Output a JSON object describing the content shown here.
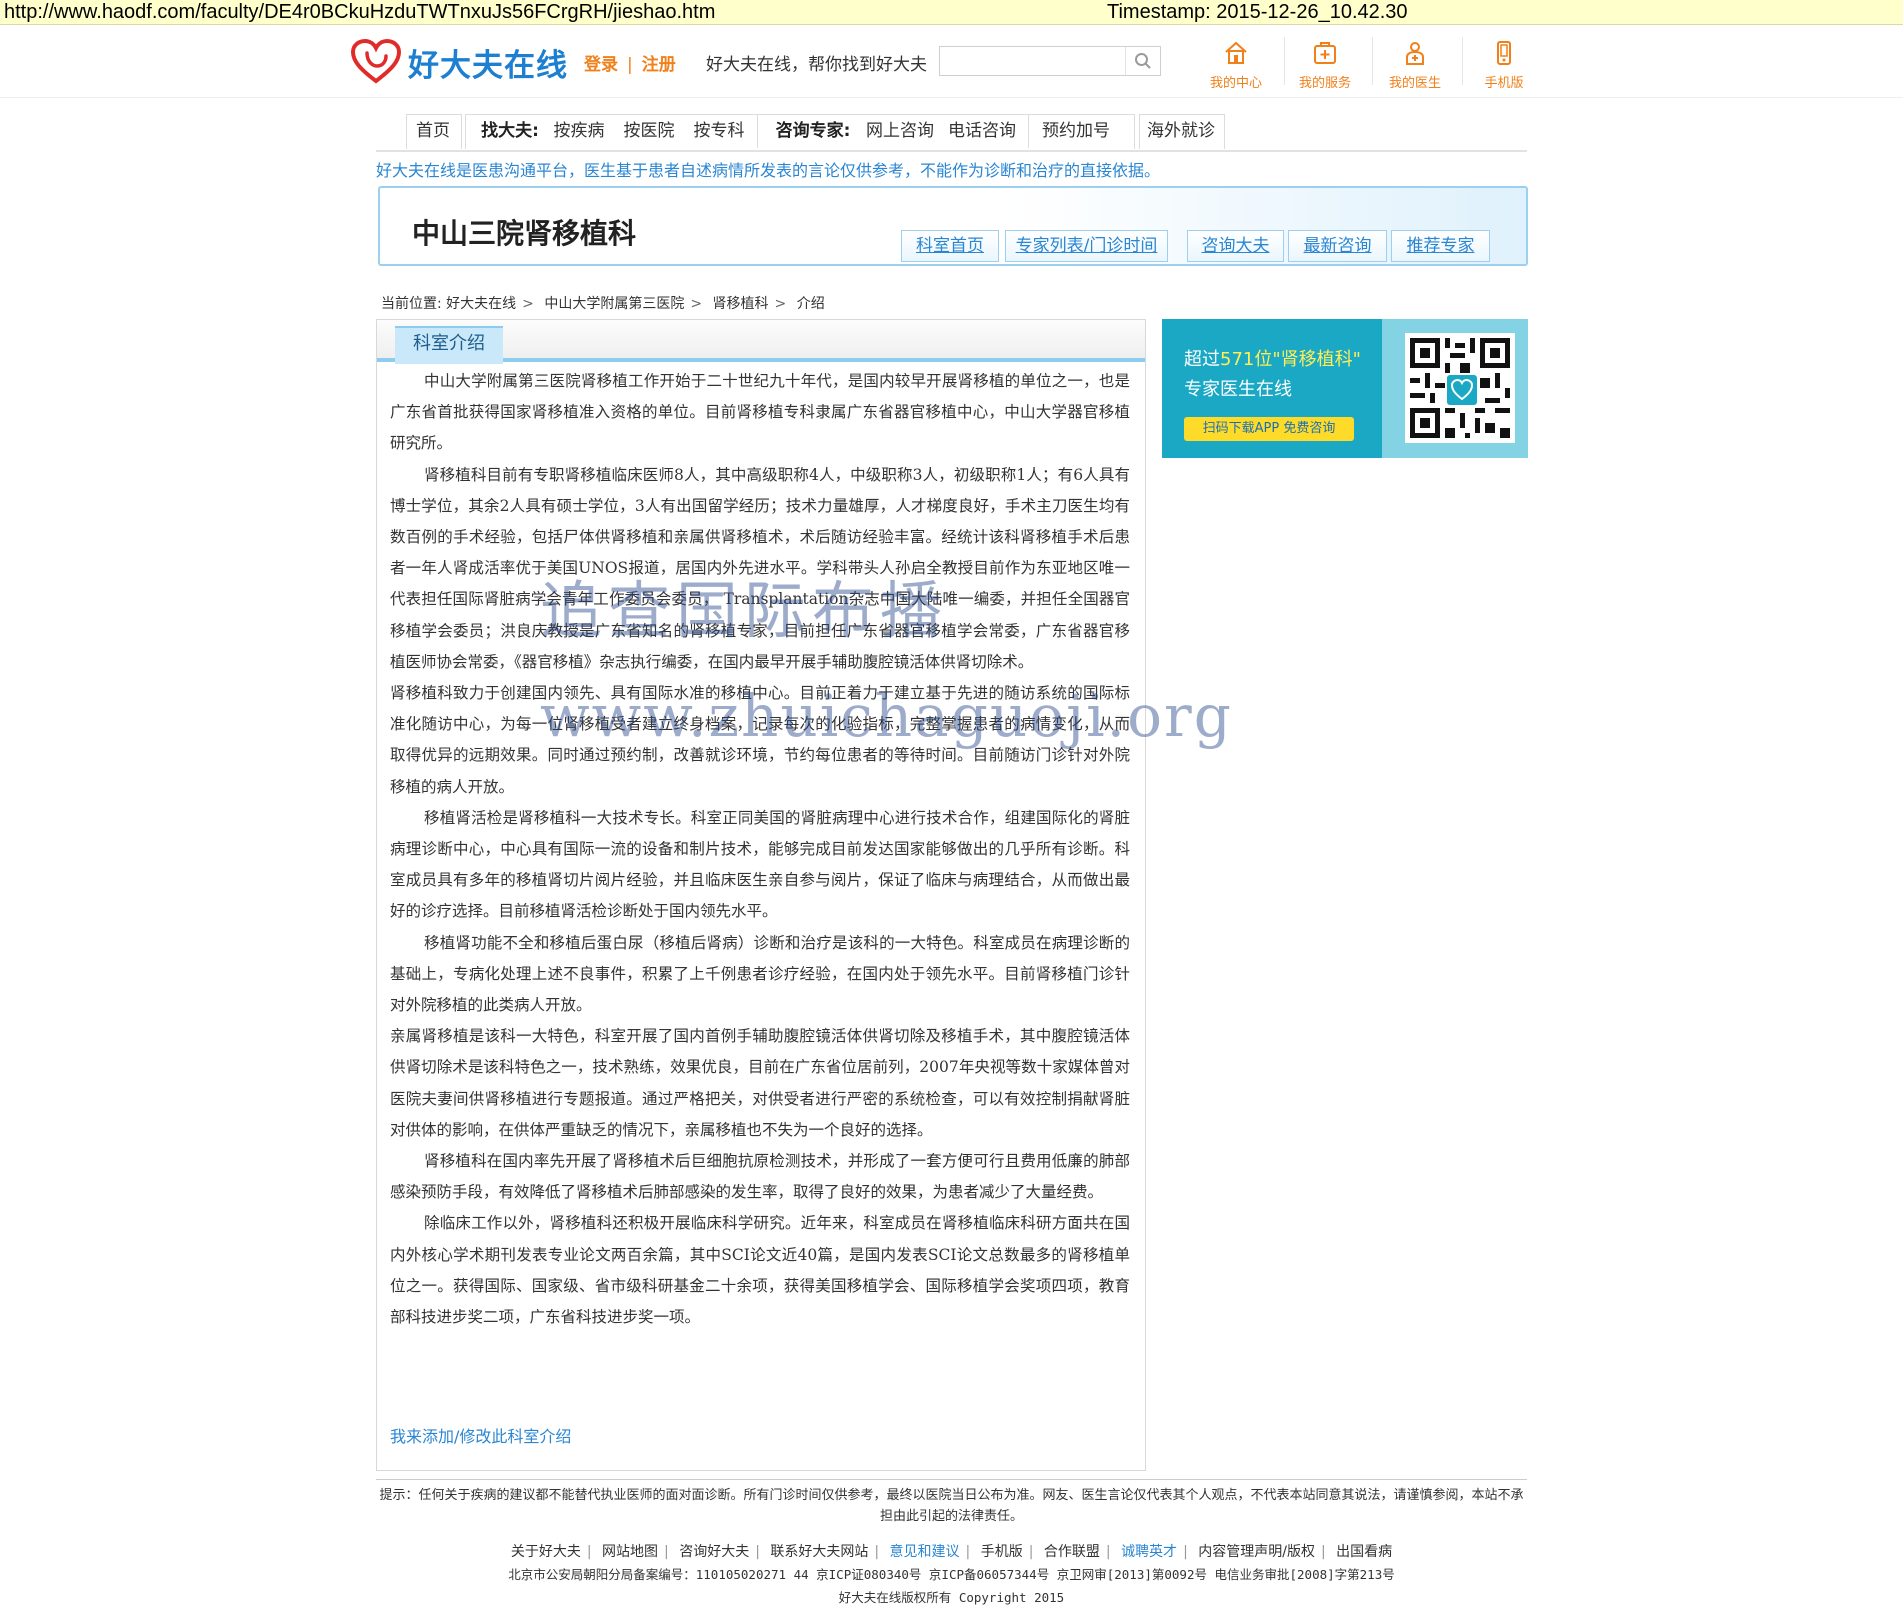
{
  "archive": {
    "url": "http://www.haodf.com/faculty/DE4r0BCkuHzduTWTnxuJs56FCrgRH/jieshao.htm",
    "timestamp": "Timestamp: 2015-12-26_10.42.30"
  },
  "header": {
    "logo_text": "好大夫在线",
    "login": "登录",
    "separator": "|",
    "register": "注册",
    "slogan": "好大夫在线，帮你找到好大夫",
    "search_placeholder": "",
    "nav": [
      {
        "label": "我的中心",
        "icon": "home-icon"
      },
      {
        "label": "我的服务",
        "icon": "medical-kit-icon"
      },
      {
        "label": "我的医生",
        "icon": "doctor-icon"
      },
      {
        "label": "手机版",
        "icon": "mobile-phone-icon"
      }
    ]
  },
  "mainnav": {
    "home": "首页",
    "find_doctor": "找大夫:",
    "by_disease": "按疾病",
    "by_hospital": "按医院",
    "by_department": "按专科",
    "consult": "咨询专家:",
    "online_consult": "网上咨询",
    "phone_consult": "电话咨询",
    "appointment": "预约加号",
    "overseas": "海外就诊"
  },
  "notice": "好大夫在线是医患沟通平台，医生基于患者自述病情所发表的言论仅供参考，不能作为诊断和治疗的直接依据。",
  "department": {
    "title": "中山三院肾移植科",
    "tabs": [
      "科室首页",
      "专家列表/门诊时间",
      "咨询大夫",
      "最新咨询",
      "推荐专家"
    ]
  },
  "breadcrumb": {
    "current": "当前位置:",
    "items": [
      "好大夫在线",
      "中山大学附属第三医院",
      "肾移植科",
      "介绍"
    ]
  },
  "content": {
    "tab": "科室介绍",
    "paragraphs": [
      {
        "indent": true,
        "text": "中山大学附属第三医院肾移植工作开始于二十世纪九十年代，是国内较早开展肾移植的单位之一，也是广东省首批获得国家肾移植准入资格的单位。目前肾移植专科隶属广东省器官移植中心，中山大学器官移植研究所。"
      },
      {
        "indent": true,
        "text": "肾移植科目前有专职肾移植临床医师8人，其中高级职称4人，中级职称3人，初级职称1人；有6人具有博士学位，其余2人具有硕士学位，3人有出国留学经历；技术力量雄厚，人才梯度良好，手术主刀医生均有数百例的手术经验，包括尸体供肾移植和亲属供肾移植术，术后随访经验丰富。经统计该科肾移植手术后患者一年人肾成活率优于美国UNOS报道，居国内外先进水平。学科带头人孙启全教授目前作为东亚地区唯一代表担任国际肾脏病学会青年工作委员会委员， Transplantation杂志中国大陆唯一编委，并担任全国器官移植学会委员；洪良庆教授是广东省知名的肾移植专家，目前担任广东省器官移植学会常委，广东省器官移植医师协会常委，《器官移植》杂志执行编委，在国内最早开展手辅助腹腔镜活体供肾切除术。"
      },
      {
        "indent": false,
        "text": "肾移植科致力于创建国内领先、具有国际水准的移植中心。目前正着力于建立基于先进的随访系统的国际标准化随访中心，为每一位肾移植受者建立终身档案，记录每次的化验指标，完整掌握患者的病情变化，从而取得优异的远期效果。同时通过预约制，改善就诊环境，节约每位患者的等待时间。目前随访门诊针对外院移植的病人开放。"
      },
      {
        "indent": true,
        "text": "移植肾活检是肾移植科一大技术专长。科室正同美国的肾脏病理中心进行技术合作，组建国际化的肾脏病理诊断中心，中心具有国际一流的设备和制片技术，能够完成目前发达国家能够做出的几乎所有诊断。科室成员具有多年的移植肾切片阅片经验，并且临床医生亲自参与阅片，保证了临床与病理结合，从而做出最好的诊疗选择。目前移植肾活检诊断处于国内领先水平。"
      },
      {
        "indent": true,
        "text": "移植肾功能不全和移植后蛋白尿（移植后肾病）诊断和治疗是该科的一大特色。科室成员在病理诊断的基础上，专病化处理上述不良事件，积累了上千例患者诊疗经验，在国内处于领先水平。目前肾移植门诊针对外院移植的此类病人开放。"
      },
      {
        "indent": false,
        "text": "亲属肾移植是该科一大特色，科室开展了国内首例手辅助腹腔镜活体供肾切除及移植手术，其中腹腔镜活体供肾切除术是该科特色之一，技术熟练，效果优良，目前在广东省位居前列，2007年央视等数十家媒体曾对医院夫妻间供肾移植进行专题报道。通过严格把关，对供受者进行严密的系统检查，可以有效控制捐献肾脏对供体的影响，在供体严重缺乏的情况下，亲属移植也不失为一个良好的选择。"
      },
      {
        "indent": true,
        "text": "肾移植科在国内率先开展了肾移植术后巨细胞抗原检测技术，并形成了一套方便可行且费用低廉的肺部感染预防手段，有效降低了肾移植术后肺部感染的发生率，取得了良好的效果，为患者减少了大量经费。"
      },
      {
        "indent": true,
        "text": "除临床工作以外，肾移植科还积极开展临床科学研究。近年来，科室成员在肾移植临床科研方面共在国内外核心学术期刊发表专业论文两百余篇，其中SCI论文近40篇，是国内发表SCI论文总数最多的肾移植单位之一。获得国际、国家级、省市级科研基金二十余项，获得美国移植学会、国际移植学会奖项四项，教育部科技进步奖二项，广东省科技进步奖一项。"
      }
    ],
    "edit_link": "我来添加/修改此科室介绍"
  },
  "promo": {
    "line1_pre": "超过",
    "line1_highlight": "571位\"肾移植科\"",
    "line2": "专家医生在线",
    "button": "扫码下载APP 免费咨询"
  },
  "footer": {
    "tip": "提示：任何关于疾病的建议都不能替代执业医师的面对面诊断。所有门诊时间仅供参考，最终以医院当日公布为准。网友、医生言论仅代表其个人观点，不代表本站同意其说法，请谨慎参阅，本站不承担由此引起的法律责任。",
    "links": [
      "关于好大夫",
      "网站地图",
      "咨询好大夫",
      "联系好大夫网站",
      "意见和建议",
      "手机版",
      "合作联盟",
      "诚聘英才",
      "内容管理声明/版权",
      "出国看病"
    ],
    "registration": "北京市公安局朝阳分局备案编号：110105020271 44 京ICP证080340号 京ICP备06057344号 京卫网审[2013]第0092号 电信业务审批[2008]字第213号",
    "copyright": "好大夫在线版权所有 Copyright 2015"
  },
  "watermark": {
    "line1": "追查国际布播",
    "line2": "www.zhuichaguoji.org"
  },
  "colors": {
    "brand_blue": "#1d7fd1",
    "accent_orange": "#f0801a",
    "link_blue": "#2a86d2",
    "promo_teal": "#1ba8c5"
  }
}
